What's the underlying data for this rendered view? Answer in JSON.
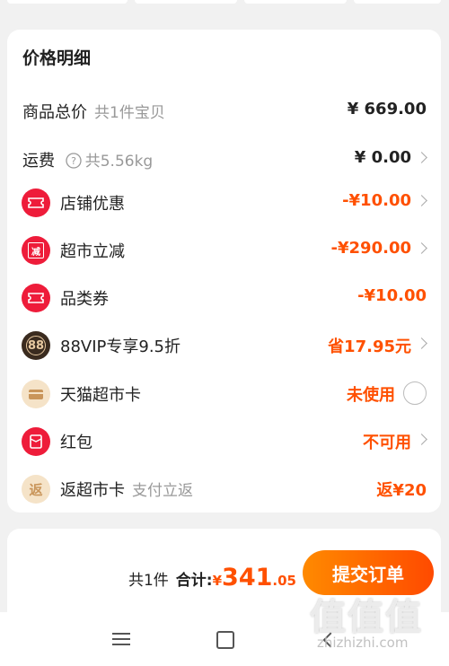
{
  "colors": {
    "accent": "#ff5000",
    "red_icon": "#ee1c3a",
    "dark_icon": "#3a2b1f",
    "beige_icon": "#f5e3c8"
  },
  "price_detail": {
    "title": "价格明细",
    "rows": [
      {
        "label": "商品总价",
        "sub": "共1件宝贝",
        "value": "¥ 669.00",
        "icon": "",
        "style": "dark",
        "chevron": false
      },
      {
        "label": "运费",
        "sub": "共5.56kg",
        "value": "¥ 0.00",
        "icon": "question-circle-icon",
        "style": "dark",
        "chevron": true
      },
      {
        "label": "店铺优惠",
        "sub": "",
        "value": "-¥10.00",
        "icon": "coupon-icon",
        "style": "orange",
        "chevron": true
      },
      {
        "label": "超市立减",
        "sub": "",
        "value": "-¥290.00",
        "icon": "reduce-icon",
        "style": "orange",
        "chevron": true
      },
      {
        "label": "品类券",
        "sub": "",
        "value": "-¥10.00",
        "icon": "category-coupon-icon",
        "style": "orange",
        "chevron": false
      },
      {
        "label": "88VIP专享9.5折",
        "sub": "",
        "value": "省17.95元",
        "icon": "88vip-icon",
        "style": "orange",
        "chevron": true
      },
      {
        "label": "天猫超市卡",
        "sub": "",
        "value": "未使用",
        "icon": "gift-card-icon",
        "style": "orange",
        "chevron": false,
        "radio": true
      },
      {
        "label": "红包",
        "sub": "",
        "value": "不可用",
        "icon": "red-packet-icon",
        "style": "orange",
        "chevron": true
      },
      {
        "label": "返超市卡",
        "sub": "支付立返",
        "value": "返¥20",
        "icon": "rebate-icon",
        "style": "orange",
        "chevron": false
      }
    ],
    "icon_glyphs": {
      "reduce": "减",
      "vip": "88",
      "rebate": "返"
    }
  },
  "footer": {
    "count": "共1件",
    "total_label": "合计:",
    "currency": "¥",
    "amount_int": "341",
    "amount_dec": ".05",
    "submit_label": "提交订单"
  },
  "watermark": {
    "mark": "值值值",
    "url": "zhizhizhi.com"
  }
}
